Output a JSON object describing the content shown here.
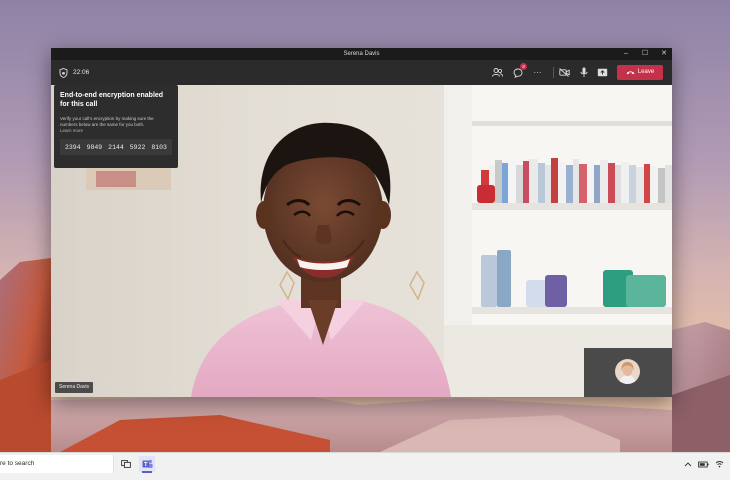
{
  "window": {
    "title": "Serena Davis",
    "controls": {
      "minimize": "–",
      "maximize": "☐",
      "close": "✕"
    }
  },
  "call_bar": {
    "timer": "22:06",
    "chat_badge": "3",
    "more": "···",
    "leave_label": "Leave",
    "leave_color": "#c4314b"
  },
  "e2e_panel": {
    "title": "End-to-end encryption enabled for this call",
    "body": "Verify your call's encryption by making sure the numbers below are the same for you both.",
    "link": "Learn more",
    "codes": [
      "2394",
      "9849",
      "2144",
      "5922",
      "8103"
    ]
  },
  "participant": {
    "name_tag": "Serena Davis"
  },
  "taskbar": {
    "search_text": "re to search"
  },
  "icons": {
    "shield": "shield-icon",
    "people": "people-icon",
    "chat": "chat-icon",
    "more": "more-icon",
    "camera": "camera-off-icon",
    "mic": "microphone-icon",
    "share": "share-screen-icon",
    "phone": "phone-hangup-icon",
    "task_view": "task-view-icon",
    "teams": "teams-icon"
  }
}
